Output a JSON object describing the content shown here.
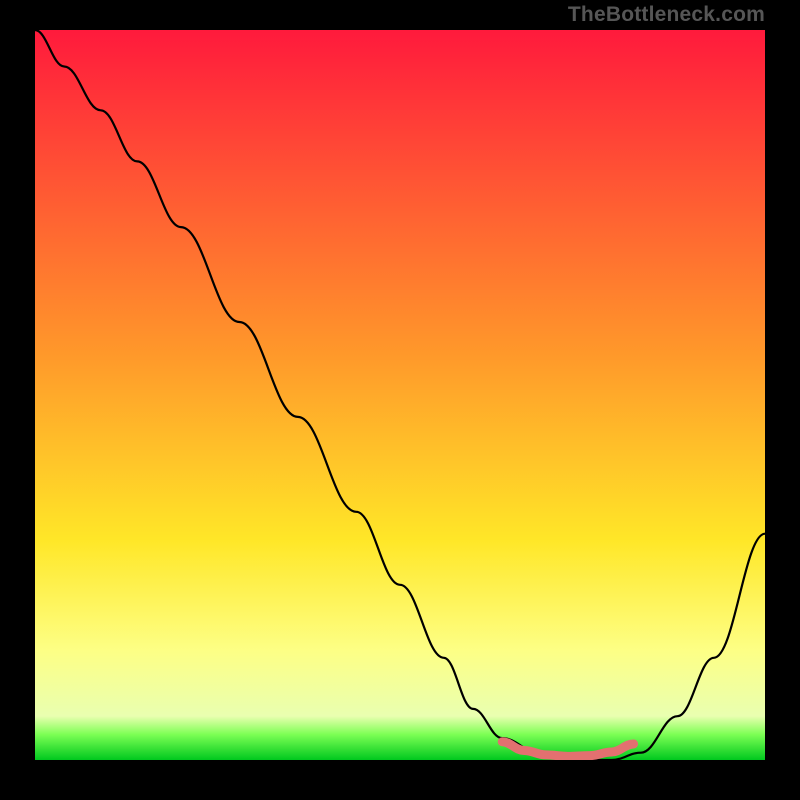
{
  "watermark": "TheBottleneck.com",
  "colors": {
    "top": "#ff1a3c",
    "mid_top": "#ff9a2a",
    "mid": "#ffe728",
    "mid_low": "#fdff66",
    "low_band": "#f7ffa0",
    "green": "#18e63a",
    "bottom_green": "#00c81e",
    "curve": "#000000",
    "flat_segment": "#e37070"
  },
  "chart_data": {
    "type": "line",
    "title": "",
    "xlabel": "",
    "ylabel": "",
    "xlim": [
      0,
      100
    ],
    "ylim": [
      0,
      100
    ],
    "series": [
      {
        "name": "curve",
        "x": [
          0,
          4,
          9,
          14,
          20,
          28,
          36,
          44,
          50,
          56,
          60,
          64,
          69,
          74,
          79,
          83,
          88,
          93,
          100
        ],
        "y": [
          100,
          95,
          89,
          82,
          73,
          60,
          47,
          34,
          24,
          14,
          7,
          3,
          1,
          0,
          0,
          1,
          6,
          14,
          31
        ]
      },
      {
        "name": "flat-zone",
        "x": [
          64,
          67,
          70,
          73,
          76,
          79,
          82
        ],
        "y": [
          2.5,
          1.3,
          0.7,
          0.5,
          0.6,
          1.1,
          2.2
        ]
      }
    ],
    "gradient_stops": [
      {
        "pct": 0,
        "color": "#ff1a3c"
      },
      {
        "pct": 45,
        "color": "#ff9a2a"
      },
      {
        "pct": 70,
        "color": "#ffe728"
      },
      {
        "pct": 85,
        "color": "#fdff85"
      },
      {
        "pct": 94,
        "color": "#e9ffb0"
      },
      {
        "pct": 96.5,
        "color": "#7cff54"
      },
      {
        "pct": 100,
        "color": "#00c81e"
      }
    ]
  }
}
